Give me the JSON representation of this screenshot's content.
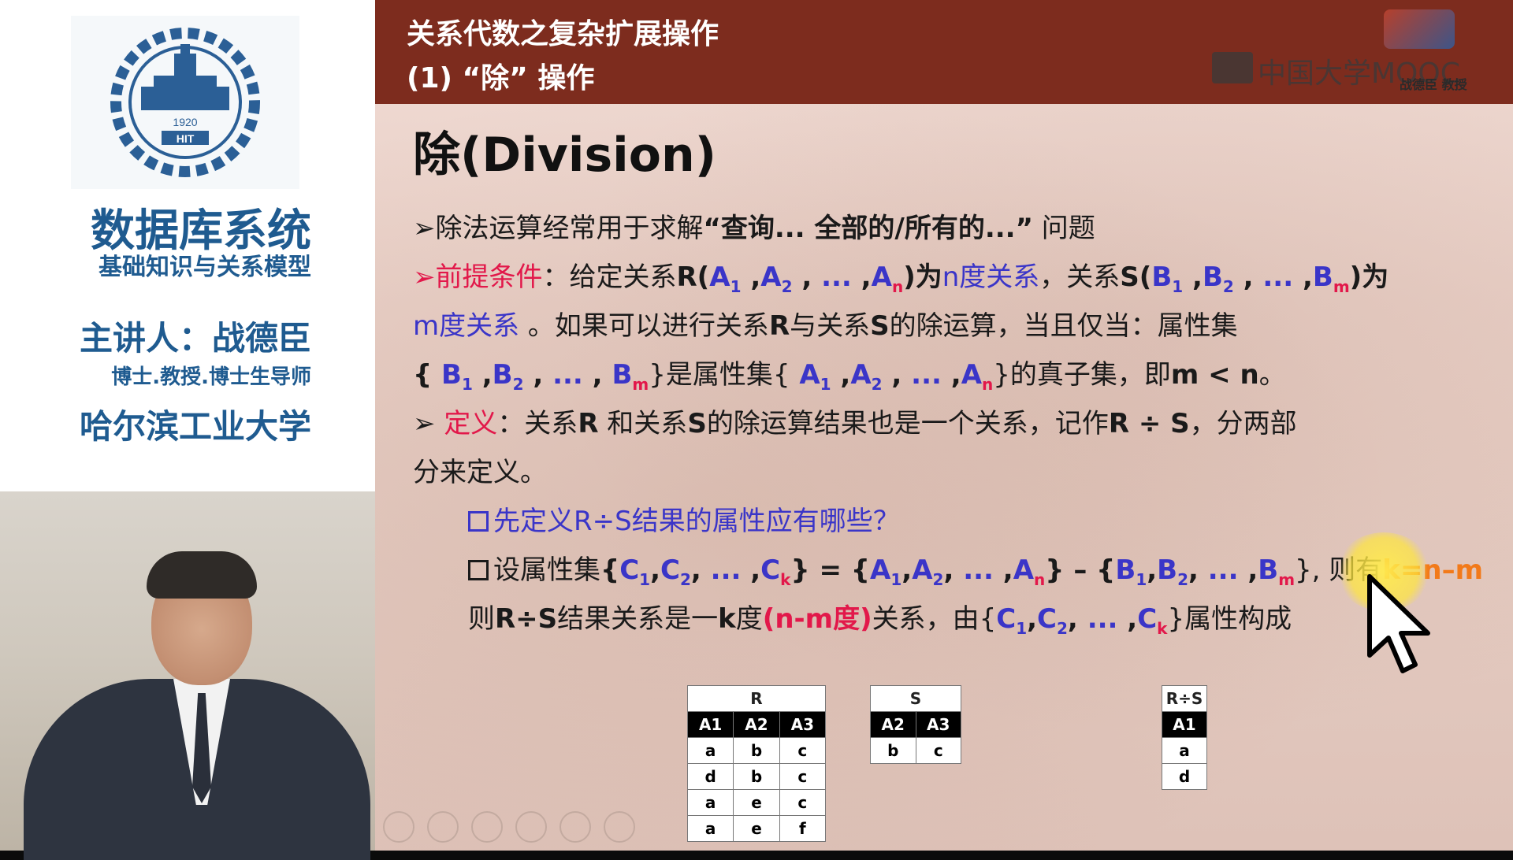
{
  "sidebar": {
    "course_title": "数据库系统",
    "course_subtitle": "基础知识与关系模型",
    "lecturer": "主讲人：战德臣",
    "lecturer_title": "博士.教授.博士生导师",
    "university": "哈尔滨工业大学",
    "logo_year": "1920",
    "logo_text": "HIT"
  },
  "header": {
    "title": "关系代数之复杂扩展操作",
    "subtitle": "(1) “除” 操作",
    "mooc_watermark": "中国大学MOOC",
    "brand_tag": "战德臣 教授"
  },
  "slide": {
    "title": "除(Division)",
    "bullet1": {
      "arrow": "➢",
      "text": "除法运算经常用于求解",
      "quote": "“查询... 全部的/所有的...”",
      "tail": " 问题"
    },
    "bullet2": {
      "arrow": "➢",
      "label": "前提条件",
      "colon": "：给定关系",
      "r_head": "R(",
      "a": "A",
      "n": "n",
      "r_tail": ")为",
      "n_degree": "n度关系",
      "comma": "，关系",
      "s_head": "S(",
      "b": "B",
      "m": "m",
      "s_tail": ")为",
      "m_degree": "m度关系",
      "line2_rest": " 。如果可以进行关系",
      "r": "R",
      "with_rel": "与关系",
      "s": "S",
      "div_cond": "的除运算，当且仅当：属性集",
      "line3_mid": "}是属性集{",
      "line3_tail": "}的真子集，即",
      "ineq": "m < n",
      "period": "。"
    },
    "bullet3": {
      "arrow": "➢",
      "label": "定义",
      "text": "：关系",
      "r": "R",
      "and_rel": " 和关系",
      "s": "S",
      "rest": "的除运算结果也是一个关系，记作",
      "expr": "R ÷ S",
      "tail": "，分两部",
      "line2": "分来定义。"
    },
    "sub1": "先定义R÷S结果的属性应有哪些？",
    "sub2": {
      "lead": "设属性集",
      "c": "C",
      "k": "k",
      "eq": "} = {",
      "minus": "} – {",
      "tail": "}, 则有",
      "formula": "k=n–m"
    },
    "sub3": {
      "lead": "则",
      "expr": "R÷S",
      "mid": "结果关系是一",
      "k": "k",
      "deg": "度",
      "paren": "(n-m度)",
      "rel": "关系，由{",
      "tail": "}属性构成"
    },
    "ellipsis": "...",
    "sub1_idx": "1",
    "sub2_idx": "2"
  },
  "tables": {
    "R": {
      "name": "R",
      "headers": [
        "A1",
        "A2",
        "A3"
      ],
      "rows": [
        [
          "a",
          "b",
          "c"
        ],
        [
          "d",
          "b",
          "c"
        ],
        [
          "a",
          "e",
          "c"
        ],
        [
          "a",
          "e",
          "f"
        ]
      ]
    },
    "S": {
      "name": "S",
      "headers": [
        "A2",
        "A3"
      ],
      "rows": [
        [
          "b",
          "c"
        ]
      ]
    },
    "RS": {
      "name": "R÷S",
      "headers": [
        "A1"
      ],
      "rows": [
        [
          "a"
        ],
        [
          "d"
        ]
      ]
    }
  },
  "colors": {
    "header_bg": "#7d2c1e",
    "accent_red": "#e2184a",
    "accent_blue": "#3a35c8",
    "sidebar_text": "#1f5b90"
  }
}
